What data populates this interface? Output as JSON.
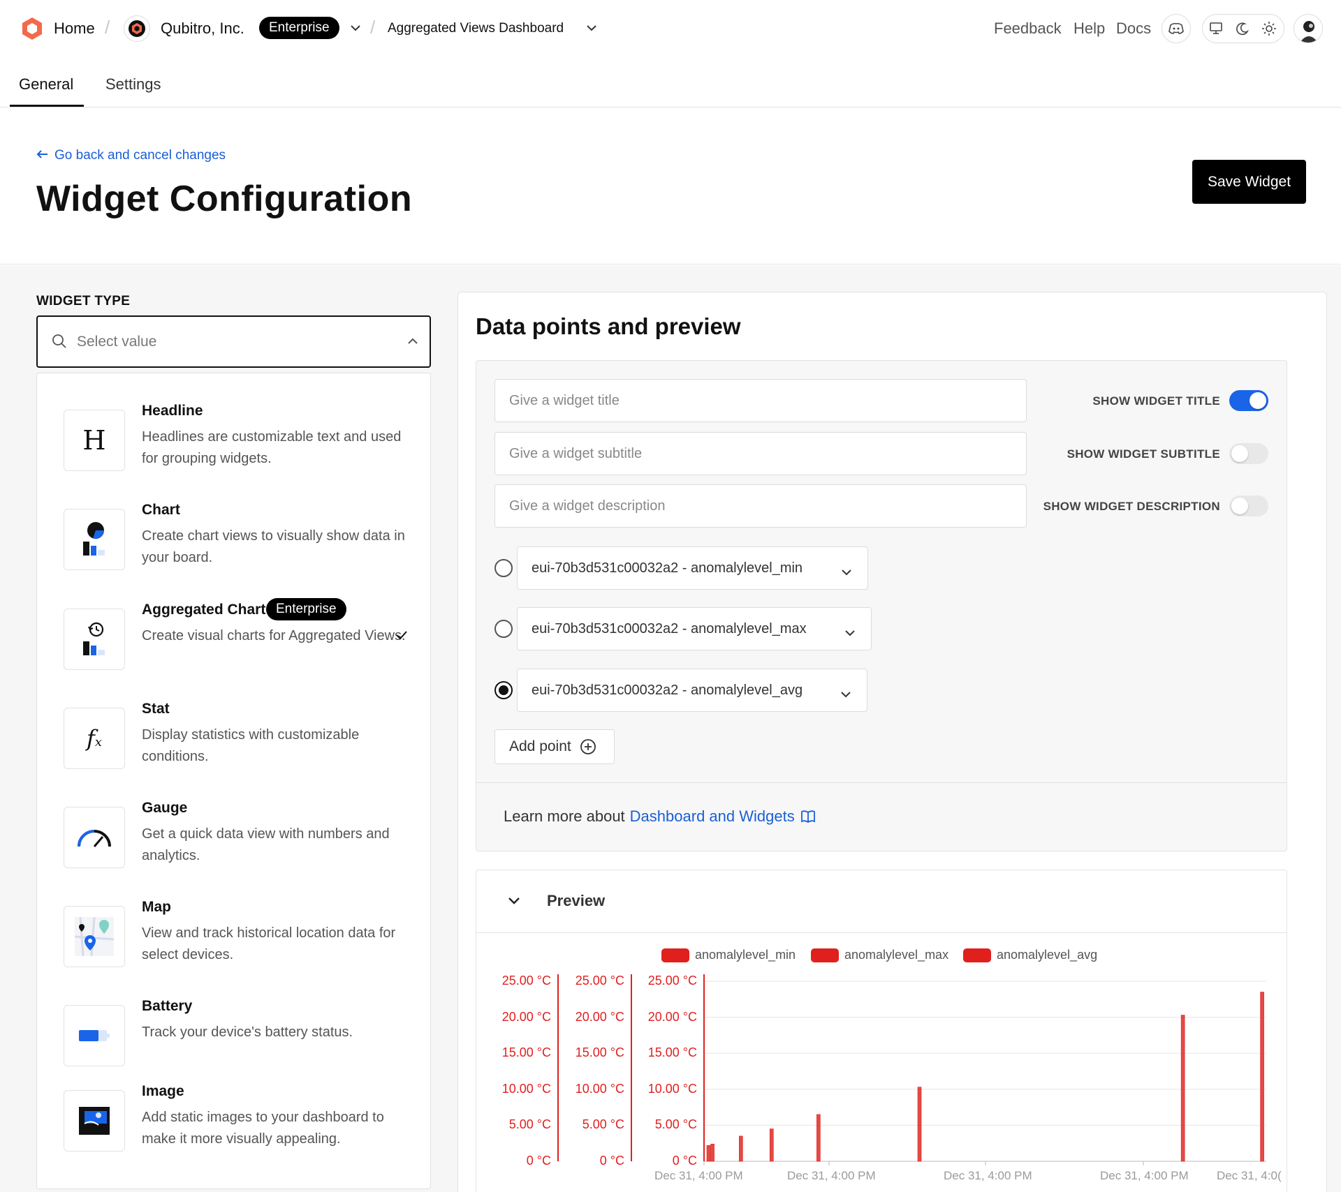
{
  "topbar": {
    "home_label": "Home",
    "org_name": "Qubitro, Inc.",
    "org_badge": "Enterprise",
    "dashboard_name": "Aggregated Views Dashboard",
    "links": {
      "feedback": "Feedback",
      "help": "Help",
      "docs": "Docs"
    }
  },
  "tabs": {
    "general": "General",
    "settings": "Settings"
  },
  "header": {
    "back_link": "Go back and cancel changes",
    "title": "Widget Configuration",
    "save_button": "Save Widget"
  },
  "widget_type": {
    "label": "WIDGET TYPE",
    "select_placeholder": "Select value",
    "items": [
      {
        "title": "Headline",
        "desc": "Headlines are customizable text and used for grouping widgets.",
        "icon": "headline-icon"
      },
      {
        "title": "Chart",
        "desc": "Create chart views to visually show data in your board.",
        "icon": "chart-icon"
      },
      {
        "title": "Aggregated Chart",
        "badge": "Enterprise",
        "desc": "Create visual charts for Aggregated Views.",
        "icon": "aggregated-chart-icon",
        "selected": true
      },
      {
        "title": "Stat",
        "desc": "Display statistics with customizable conditions.",
        "icon": "function-icon"
      },
      {
        "title": "Gauge",
        "desc": "Get a quick data view with numbers and analytics.",
        "icon": "gauge-icon"
      },
      {
        "title": "Map",
        "desc": "View and track historical location data for select devices.",
        "icon": "map-icon"
      },
      {
        "title": "Battery",
        "desc": "Track your device's battery status.",
        "icon": "battery-icon"
      },
      {
        "title": "Image",
        "desc": "Add static images to your dashboard to make it more visually appealing.",
        "icon": "image-icon"
      }
    ]
  },
  "data_points": {
    "heading": "Data points and preview",
    "title_placeholder": "Give a widget title",
    "subtitle_placeholder": "Give a widget subtitle",
    "description_placeholder": "Give a widget description",
    "toggles": {
      "title": {
        "label": "SHOW WIDGET TITLE",
        "on": true
      },
      "subtitle": {
        "label": "SHOW WIDGET SUBTITLE",
        "on": false
      },
      "description": {
        "label": "SHOW WIDGET DESCRIPTION",
        "on": false
      }
    },
    "points": [
      {
        "label": "eui-70b3d531c00032a2 - anomalylevel_min",
        "selected": false
      },
      {
        "label": "eui-70b3d531c00032a2 - anomalylevel_max",
        "selected": false
      },
      {
        "label": "eui-70b3d531c00032a2 - anomalylevel_avg",
        "selected": true
      }
    ],
    "add_point": "Add point",
    "learn_more_prefix": "Learn more about",
    "learn_more_link": "Dashboard and Widgets"
  },
  "preview": {
    "label": "Preview"
  },
  "colors": {
    "accent_blue": "#1a64e8",
    "series_red": "#e0201c",
    "badge_black": "#000000"
  },
  "chart_data": {
    "type": "bar",
    "series_names": [
      "anomalylevel_min",
      "anomalylevel_max",
      "anomalylevel_avg"
    ],
    "y_ticks": [
      "25.00 °C",
      "20.00 °C",
      "15.00 °C",
      "10.00 °C",
      "5.00 °C",
      "0 °C"
    ],
    "ylim": [
      0,
      25
    ],
    "x_ticks": [
      "Dec 31, 4:00 PM",
      "Dec 31, 4:00 PM",
      "Dec 31, 4:00 PM",
      "Dec 31, 4:00 PM",
      "Dec 31, 4:0("
    ],
    "bars": [
      {
        "x": 0.005,
        "value": 2.2
      },
      {
        "x": 0.012,
        "value": 2.4
      },
      {
        "x": 0.063,
        "value": 3.5
      },
      {
        "x": 0.118,
        "value": 4.5
      },
      {
        "x": 0.202,
        "value": 6.5
      },
      {
        "x": 0.383,
        "value": 10.3
      },
      {
        "x": 0.855,
        "value": 20.3
      },
      {
        "x": 0.997,
        "value": 23.5
      }
    ],
    "grid": true,
    "legend": "top-center"
  }
}
